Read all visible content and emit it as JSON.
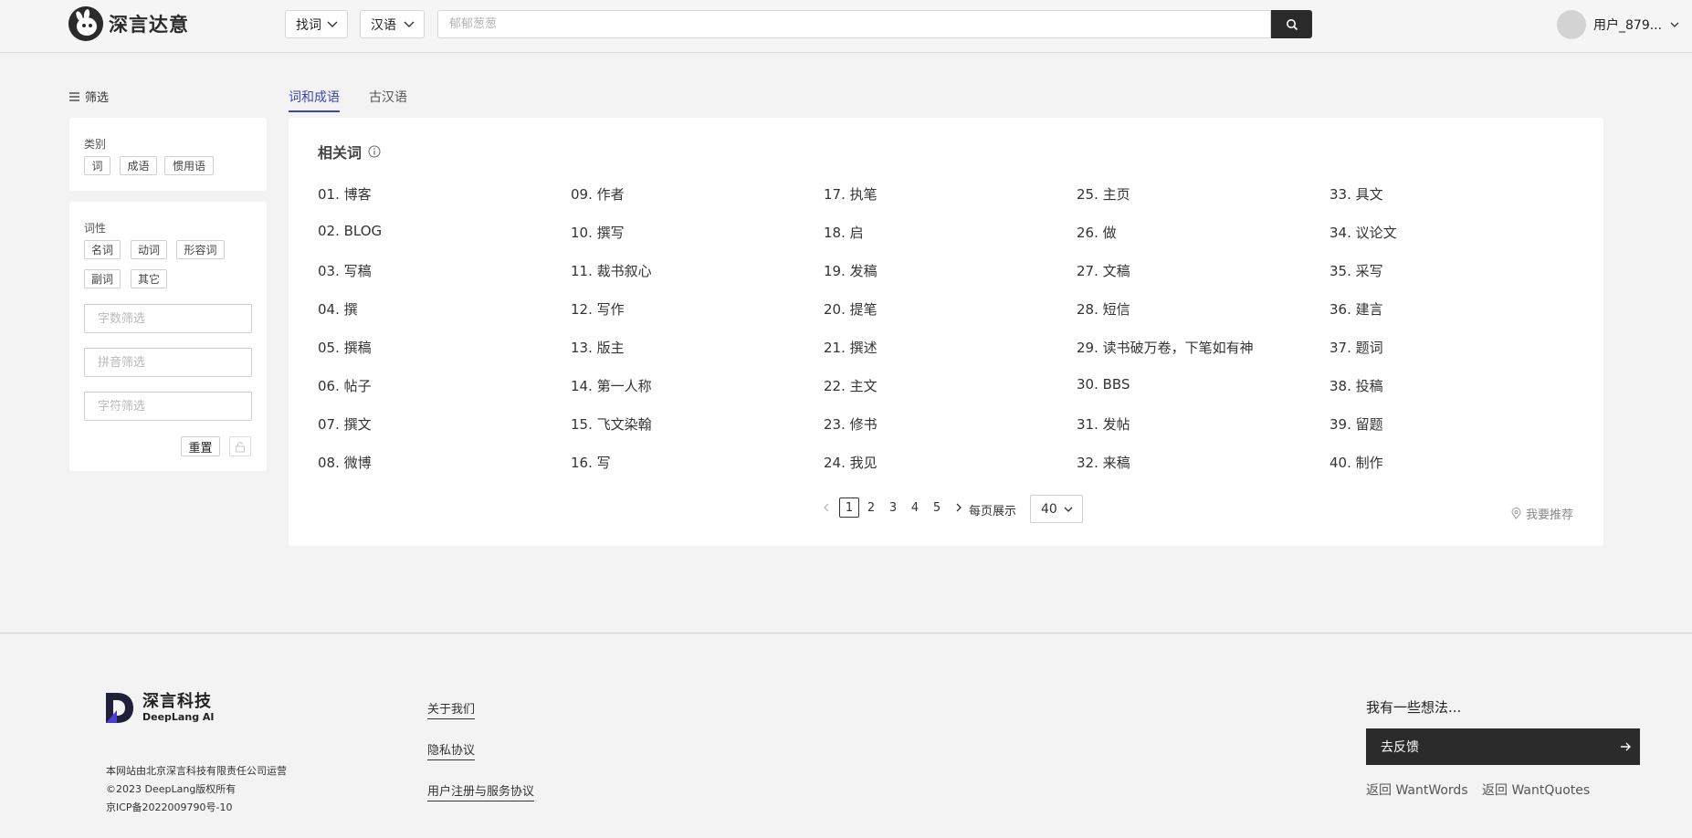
{
  "header": {
    "logo_text": "深言达意",
    "mode_select": "找词",
    "lang_select": "汉语",
    "search_placeholder": "郁郁葱葱",
    "user_name": "用户_879..."
  },
  "sidebar": {
    "title": "筛选",
    "category_label": "类别",
    "category_chips": [
      "词",
      "成语",
      "惯用语"
    ],
    "pos_label": "词性",
    "pos_chips": [
      "名词",
      "动词",
      "形容词",
      "副词",
      "其它"
    ],
    "count_placeholder": "字数筛选",
    "pinyin_placeholder": "拼音筛选",
    "char_placeholder": "字符筛选",
    "reset_label": "重置"
  },
  "tabs": [
    "词和成语",
    "古汉语"
  ],
  "results": {
    "title": "相关词",
    "words": [
      "01. 博客",
      "02. BLOG",
      "03. 写稿",
      "04. 撰",
      "05. 撰稿",
      "06. 帖子",
      "07. 撰文",
      "08. 微博",
      "09. 作者",
      "10. 撰写",
      "11. 裁书叙心",
      "12. 写作",
      "13. 版主",
      "14. 第一人称",
      "15. 飞文染翰",
      "16. 写",
      "17. 执笔",
      "18. 启",
      "19. 发稿",
      "20. 提笔",
      "21. 撰述",
      "22. 主文",
      "23. 修书",
      "24. 我见",
      "25. 主页",
      "26. 做",
      "27. 文稿",
      "28. 短信",
      "29. 读书破万卷，下笔如有神",
      "30. BBS",
      "31. 发帖",
      "32. 来稿",
      "33. 具文",
      "34. 议论文",
      "35. 采写",
      "36. 建言",
      "37. 题词",
      "38. 投稿",
      "39. 留题",
      "40. 制作"
    ]
  },
  "pagination": {
    "pages": [
      "1",
      "2",
      "3",
      "4",
      "5"
    ],
    "current": "1",
    "per_page_label": "每页展示",
    "per_page_value": "40",
    "recommend_label": "我要推荐"
  },
  "footer": {
    "company_cn": "深言科技",
    "company_en": "DeepLang AI",
    "info": [
      "本网站由北京深言科技有限责任公司运营",
      "©2023 DeepLang版权所有",
      "京ICP备2022009790号-10"
    ],
    "links": [
      "关于我们",
      "隐私协议",
      "用户注册与服务协议"
    ],
    "idea_text": "我有一些想法...",
    "feedback_label": "去反馈",
    "back_links": [
      "返回 WantWords",
      "返回 WantQuotes"
    ]
  },
  "colors": {
    "accent": "#3e44b0",
    "dark": "#2b2b2b",
    "background": "#f3f3f3"
  }
}
